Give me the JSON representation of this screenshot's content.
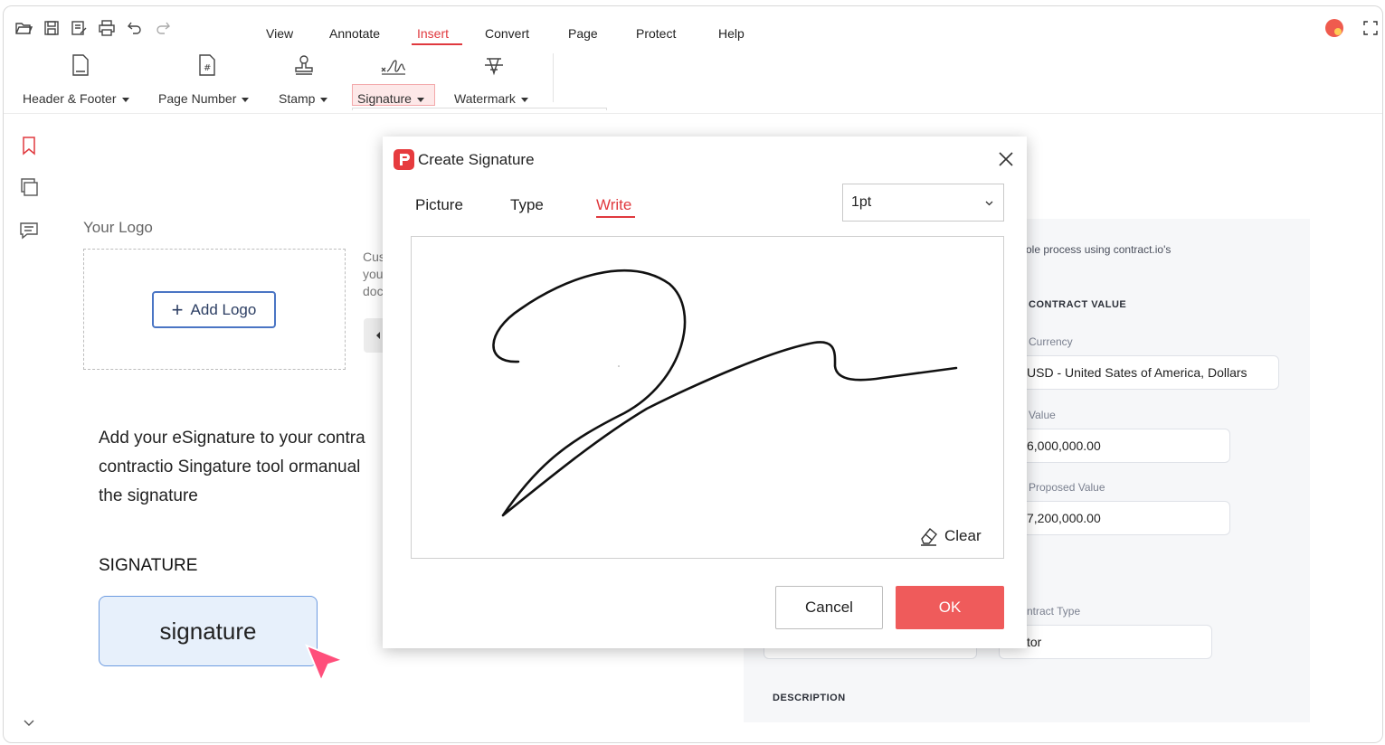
{
  "toolbar": {
    "quick_icons": [
      "open-icon",
      "save-icon",
      "save-as-icon",
      "print-icon",
      "undo-icon",
      "redo-icon"
    ],
    "menu": [
      "View",
      "Annotate",
      "Insert",
      "Convert",
      "Page",
      "Protect",
      "Help"
    ],
    "active_menu": "Insert",
    "ribbon": [
      {
        "label": "Header & Footer",
        "icon": "header-footer-icon"
      },
      {
        "label": "Page Number",
        "icon": "page-number-icon"
      },
      {
        "label": "Stamp",
        "icon": "stamp-icon"
      },
      {
        "label": "Signature",
        "icon": "signature-icon"
      },
      {
        "label": "Watermark",
        "icon": "watermark-icon"
      }
    ]
  },
  "left_rail": [
    "bookmark-icon",
    "pages-icon",
    "comment-icon"
  ],
  "document": {
    "your_logo": "Your Logo",
    "add_logo": "Add Logo",
    "side_text": [
      "Cus",
      "you",
      "doc"
    ],
    "body_lines": [
      "Add your eSignature to your contra",
      "contractio Singature tool ormanual",
      "the signature"
    ],
    "signature_heading": "SIGNATURE",
    "signature_chip": "signature"
  },
  "contract_form": {
    "intro": "ole process using contract.io's",
    "contract_value_heading": "CONTRACT VALUE",
    "currency_label": "Currency",
    "currency_value": "USD - United Sates of America, Dollars",
    "value_label": "Value",
    "value": "6,000,000.00",
    "proposed_label": "Proposed Value",
    "proposed_value": "7,200,000.00",
    "contract_type_label": "ntract Type",
    "contract_type_value": "tor",
    "description_heading": "DESCRIPTION"
  },
  "dialog": {
    "title": "Create Signature",
    "tabs": [
      "Picture",
      "Type",
      "Write"
    ],
    "active_tab": "Write",
    "stroke_width": "1pt",
    "clear": "Clear",
    "cancel": "Cancel",
    "ok": "OK",
    "accent": "#e0393e",
    "ok_color": "#ef5b5b"
  }
}
